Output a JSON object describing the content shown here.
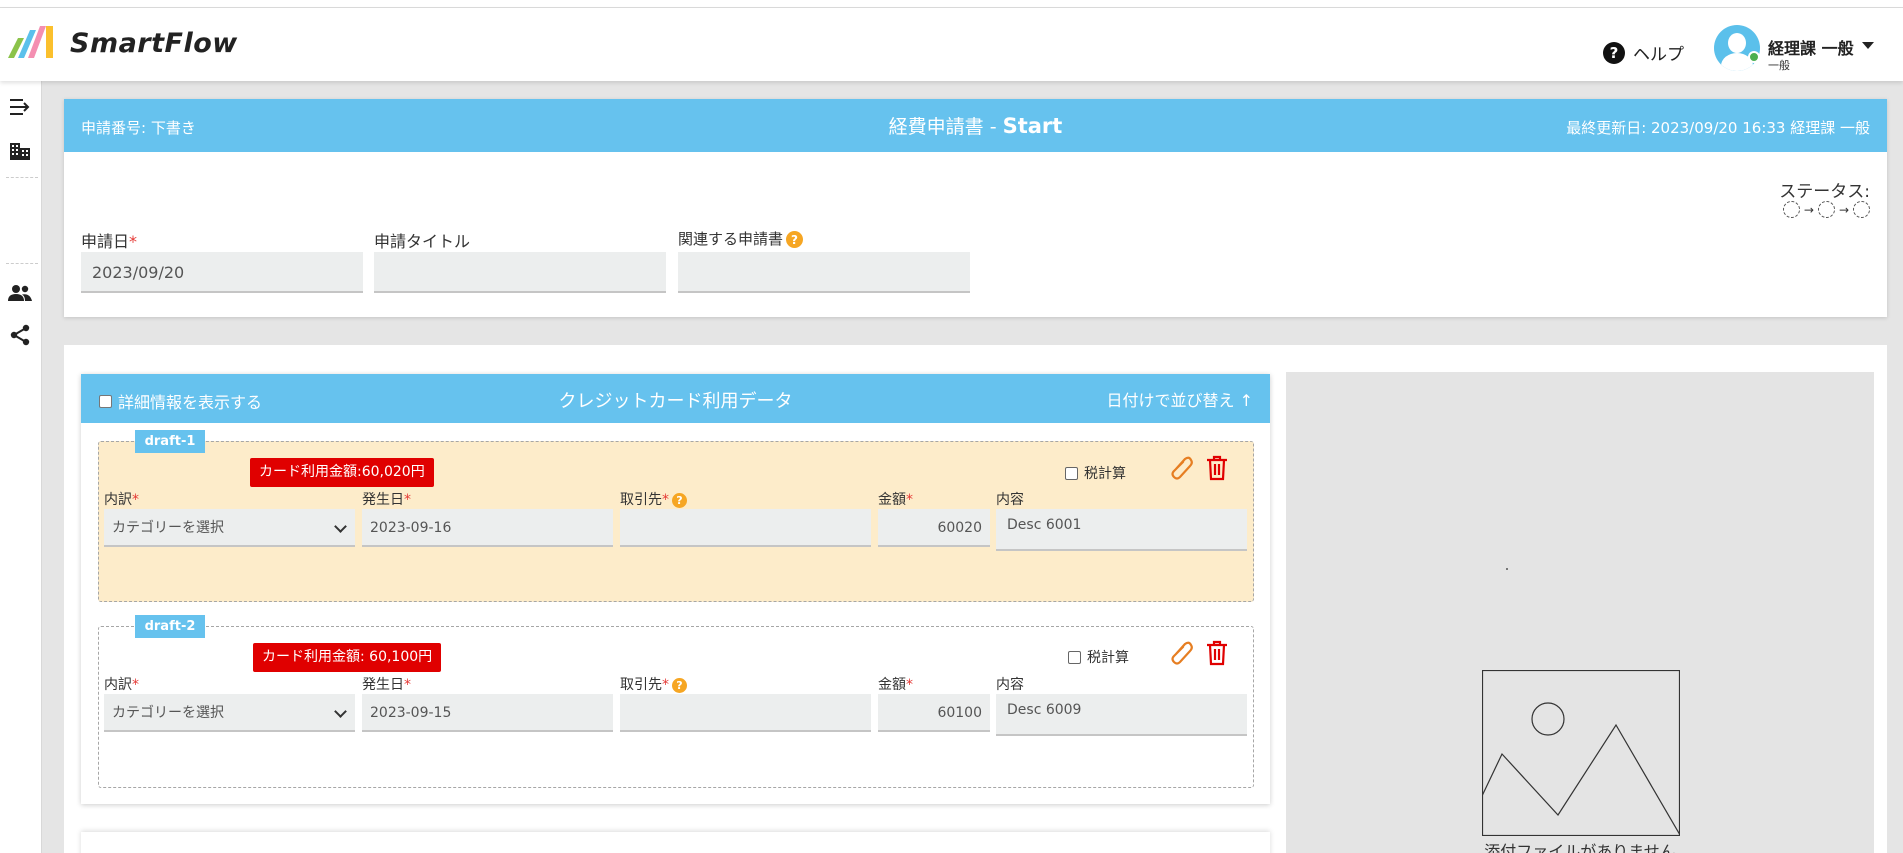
{
  "app": {
    "brand": "SmartFlow",
    "help_label": "ヘルプ",
    "user_name": "経理課 一般",
    "user_role": "一般"
  },
  "colors": {
    "accent": "#66c2ee",
    "badge": "#e00000",
    "draft_highlight": "#fdecca",
    "required": "#e53935",
    "action_icon": "#e67e22",
    "delete_icon": "#e00000"
  },
  "sidebar": {
    "items": [
      {
        "name": "collapse-menu-icon"
      },
      {
        "name": "building-icon"
      },
      {
        "name": "people-icon"
      },
      {
        "name": "share-icon"
      }
    ]
  },
  "form_header": {
    "request_number": "申請番号: 下書き",
    "title_prefix": "経費申請書 - ",
    "title_state": "Start",
    "last_updated": "最終更新日: 2023/09/20 16:33 経理課 一般"
  },
  "status": {
    "label": "ステータス:",
    "arrow": "→"
  },
  "fields": {
    "date_label": "申請日",
    "date_value": "2023/09/20",
    "title_label": "申請タイトル",
    "title_value": "",
    "related_label": "関連する申請書",
    "related_value": "",
    "required_mark": "*",
    "help_mark": "?"
  },
  "card_data": {
    "show_details_label": "詳細情報を表示する",
    "title": "クレジットカード利用データ",
    "sort_label": "日付けで並び替え ↑",
    "drafts": [
      {
        "tag": "draft-1",
        "amount_badge": "カード利用金額:60,020円",
        "tax_label": "税計算",
        "category_label": "内訳",
        "category_value": "カテゴリーを選択",
        "date_label": "発生日",
        "date_value": "2023-09-16",
        "vendor_label": "取引先",
        "vendor_value": "",
        "amount_label": "金額",
        "amount_value": "60020",
        "desc_label": "内容",
        "desc_value": "Desc 6001"
      },
      {
        "tag": "draft-2",
        "amount_badge": "カード利用金額: 60,100円",
        "tax_label": "税計算",
        "category_label": "内訳",
        "category_value": "カテゴリーを選択",
        "date_label": "発生日",
        "date_value": "2023-09-15",
        "vendor_label": "取引先",
        "vendor_value": "",
        "amount_label": "金額",
        "amount_value": "60100",
        "desc_label": "内容",
        "desc_value": "Desc 6009"
      }
    ]
  },
  "attachment": {
    "no_file_text": "添付ファイルがありません"
  }
}
